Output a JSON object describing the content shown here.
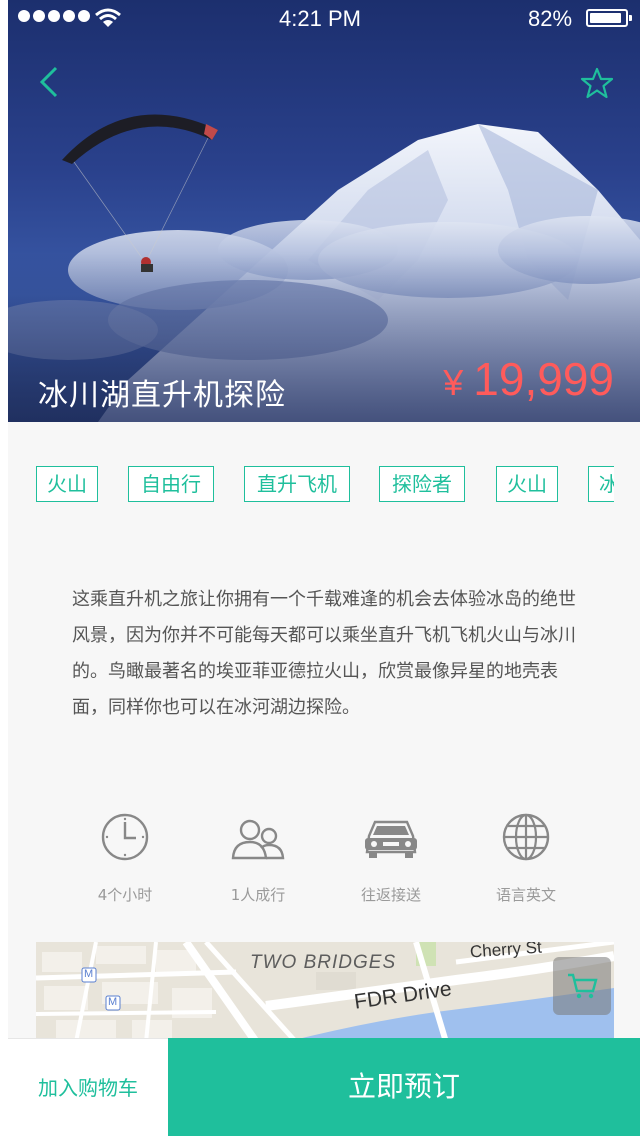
{
  "status_bar": {
    "time": "4:21 PM",
    "battery": "82%",
    "battery_level": 0.82
  },
  "hero": {
    "title": "冰川湖直升机探险",
    "price_currency": "¥",
    "price_value": "19,999",
    "back_icon": "chevron-left-icon",
    "favorite_icon": "star-outline-icon",
    "accent_color": "#1fbf9c",
    "price_color": "#ff5b5b"
  },
  "tags": [
    "火山",
    "自由行",
    "直升飞机",
    "探险者",
    "火山",
    "冰"
  ],
  "description": "这乘直升机之旅让你拥有一个千载难逢的机会去体验冰岛的绝世风景，因为你并不可能每天都可以乘坐直升飞机飞机火山与冰川的。鸟瞰最著名的埃亚菲亚德拉火山，欣赏最像异星的地壳表面，同样你也可以在冰河湖边探险。",
  "features": [
    {
      "icon": "clock-icon",
      "label": "4个小时"
    },
    {
      "icon": "people-icon",
      "label": "1人成行"
    },
    {
      "icon": "car-icon",
      "label": "往返接送"
    },
    {
      "icon": "globe-icon",
      "label": "语言英文"
    }
  ],
  "map": {
    "labels": {
      "bridges": "TWO BRIDGES",
      "fdr": "FDR Drive",
      "cherry": "Cherry St"
    },
    "metro_marker": "M",
    "cart_icon": "cart-icon"
  },
  "bottom_bar": {
    "add_cart_label": "加入购物车",
    "book_label": "立即预订"
  }
}
